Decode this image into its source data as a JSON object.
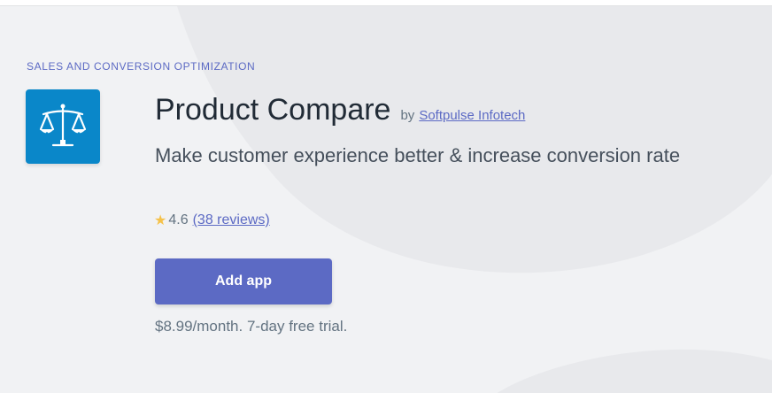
{
  "category": "SALES AND CONVERSION OPTIMIZATION",
  "app": {
    "icon": "balance-scale-icon",
    "icon_color": "#0a87c9",
    "title": "Product Compare",
    "by_label": "by",
    "developer": "Softpulse Infotech",
    "tagline": "Make customer experience better & increase conversion rate"
  },
  "rating": {
    "star": "★",
    "value": "4.6",
    "reviews_label": "(38 reviews)"
  },
  "cta": {
    "label": "Add app",
    "color": "#5c6ac4"
  },
  "pricing": "$8.99/month. 7-day free trial."
}
